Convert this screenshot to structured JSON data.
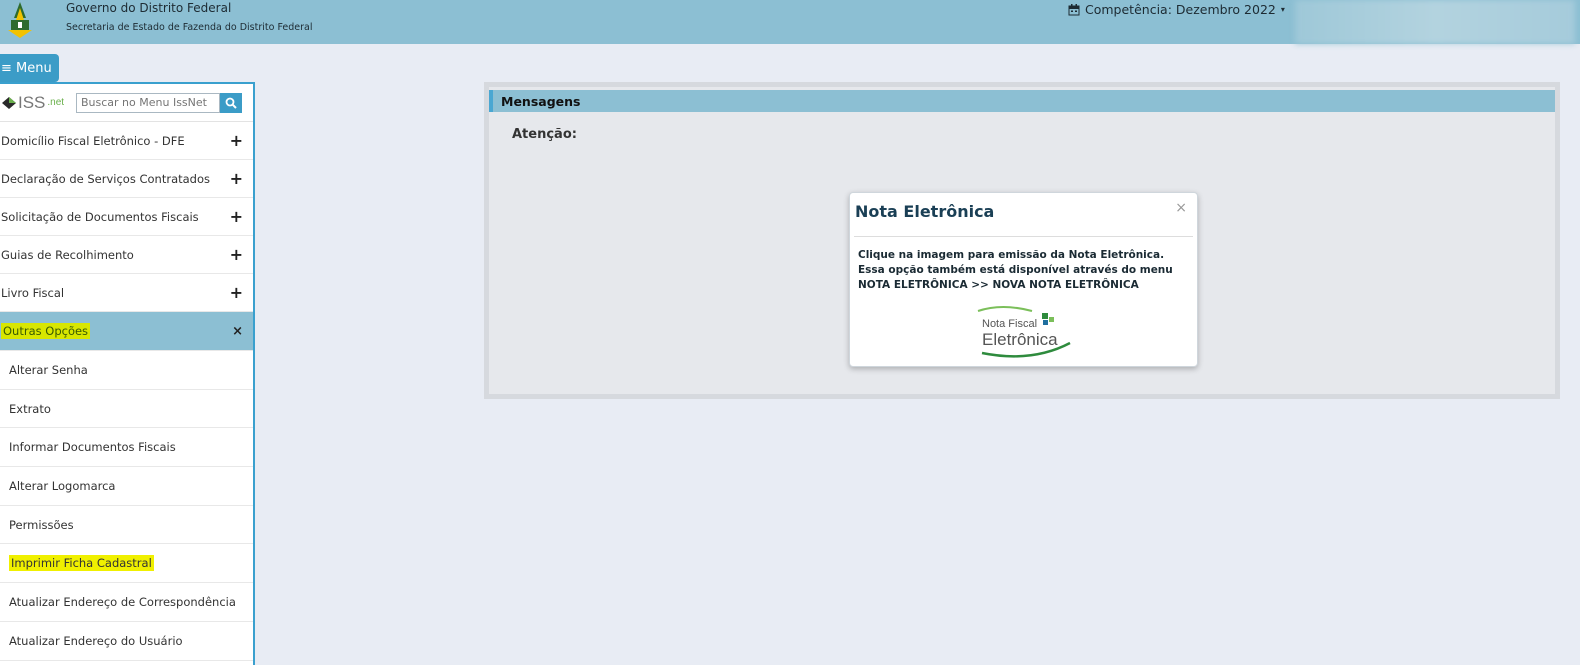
{
  "header": {
    "gov_title": "Governo do Distrito Federal",
    "gov_subtitle": "Secretaria de Estado de Fazenda do Distrito Federal",
    "competencia": "Competência: Dezembro 2022",
    "competencia_icon": "calendar-icon",
    "caret_icon": "caret-down-icon",
    "bg_color": "#8cbfd3"
  },
  "menu_button": {
    "label": "≡ Menu"
  },
  "sidebar": {
    "logo_text": "ISS",
    "logo_suffix": ".net",
    "search_placeholder": "Buscar no Menu IssNet",
    "items": [
      {
        "label": "Domicílio Fiscal Eletrônico - DFE",
        "toggle": "+"
      },
      {
        "label": "Declaração de Serviços Contratados",
        "toggle": "+"
      },
      {
        "label": "Solicitação de Documentos Fiscais",
        "toggle": "+"
      },
      {
        "label": "Guias de Recolhimento",
        "toggle": "+"
      },
      {
        "label": "Livro Fiscal",
        "toggle": "+"
      }
    ],
    "active_item": {
      "label": "Outras Opções",
      "toggle": "×"
    },
    "sub_items": [
      {
        "label": "Alterar Senha"
      },
      {
        "label": "Extrato"
      },
      {
        "label": "Informar Documentos Fiscais"
      },
      {
        "label": "Alterar Logomarca"
      },
      {
        "label": "Permissões"
      },
      {
        "label": "Imprimir Ficha Cadastral"
      },
      {
        "label": "Atualizar Endereço de Correspondência"
      },
      {
        "label": "Atualizar Endereço do Usuário"
      }
    ]
  },
  "messages": {
    "title": "Mensagens",
    "attention": "Atenção:"
  },
  "modal": {
    "title": "Nota Eletrônica",
    "close": "×",
    "line1": "Clique na imagem para emissão da Nota Eletrônica.",
    "line2": "Essa opção também está disponível através do menu NOTA ELETRÔNICA >> NOVA NOTA ELETRÔNICA",
    "logo_line1": "Nota Fiscal",
    "logo_line2": "Eletrônica"
  },
  "colors": {
    "accent": "#3b9cc7",
    "highlight": "#f0f000"
  }
}
